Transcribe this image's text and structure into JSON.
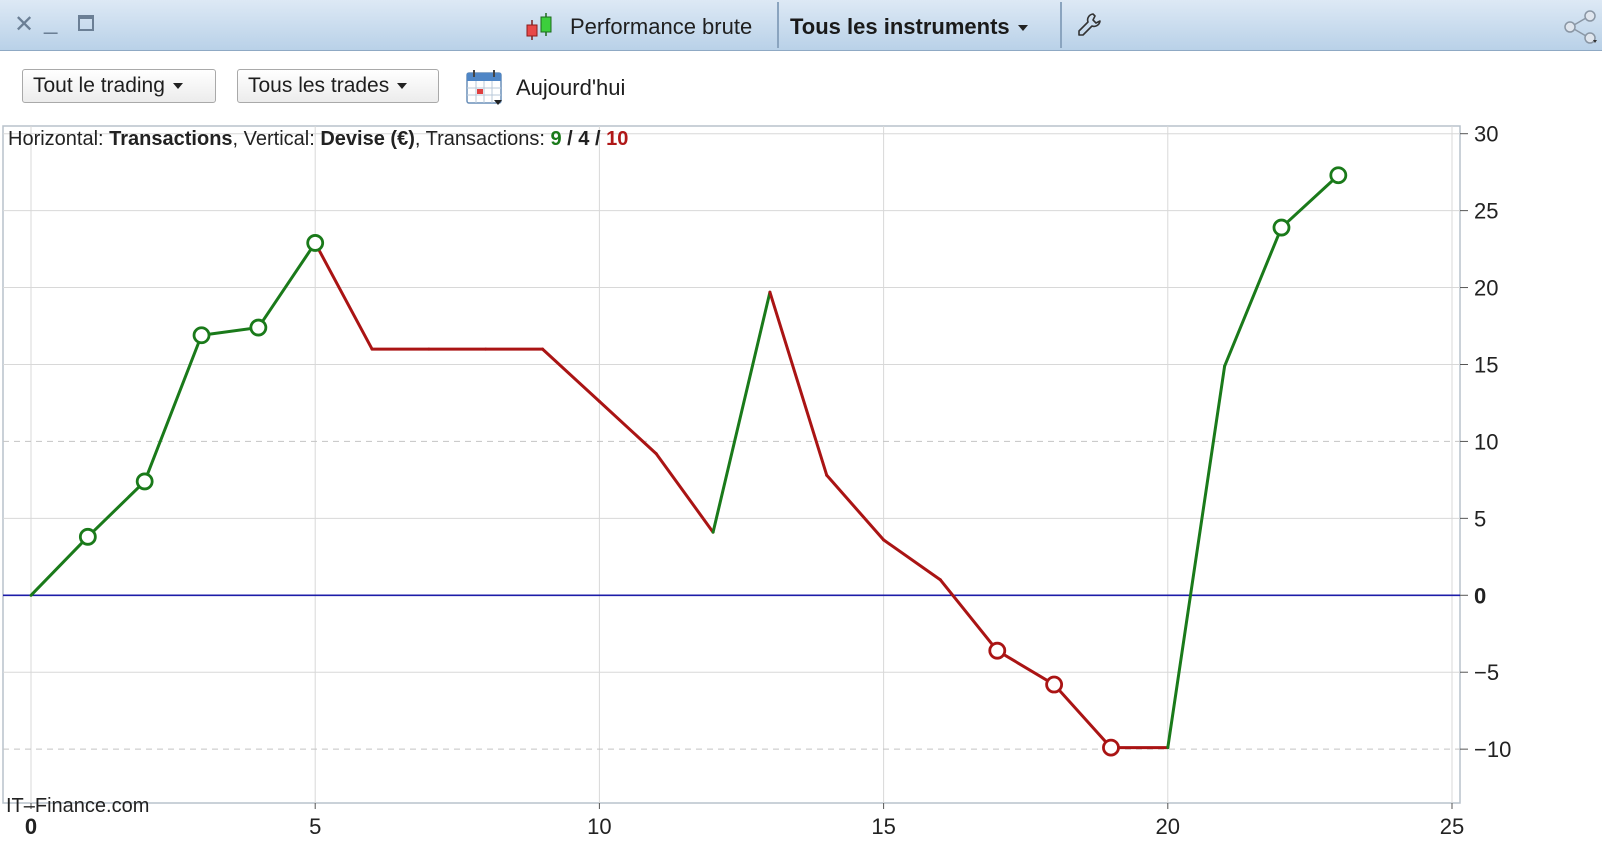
{
  "titlebar": {
    "mode_label": "Performance brute",
    "instruments_label": "Tous les instruments"
  },
  "toolbar": {
    "trading_filter": "Tout le trading",
    "trades_filter": "Tous les trades",
    "date_label": "Aujourd'hui"
  },
  "chart_info": {
    "h_prefix": "Horizontal: ",
    "h_value": "Transactions",
    "v_prefix": ", Vertical: ",
    "v_value": "Devise (€)",
    "t_prefix": ", Transactions: ",
    "count_green": "9",
    "sep1": " / ",
    "count_neutral": "4",
    "sep2": " / ",
    "count_red": "10"
  },
  "watermark": "IT–Finance.com",
  "colors": {
    "gain": "#1a7a1a",
    "loss": "#aa1414",
    "zero_line": "#1c1ca8",
    "grid": "#d8d8d8"
  },
  "chart_data": {
    "type": "line",
    "x": [
      0,
      1,
      2,
      3,
      4,
      5,
      6,
      7,
      8,
      9,
      10,
      11,
      12,
      13,
      14,
      15,
      16,
      17,
      18,
      19,
      20,
      21,
      22,
      23
    ],
    "values": [
      0,
      3.8,
      7.4,
      16.9,
      17.4,
      22.9,
      16.0,
      16.0,
      16.0,
      16.0,
      12.6,
      9.2,
      4.1,
      19.7,
      7.8,
      3.6,
      1.0,
      -3.6,
      -5.8,
      -9.9,
      -9.9,
      14.9,
      23.9,
      27.3
    ],
    "markers": [
      1,
      2,
      3,
      4,
      5,
      17,
      18,
      19,
      22,
      23
    ],
    "xlim": [
      0,
      25
    ],
    "ylim": [
      -13.5,
      30.5
    ],
    "xticks": [
      0,
      5,
      10,
      15,
      20,
      25
    ],
    "yticks": [
      30,
      25,
      20,
      15,
      10,
      5,
      0,
      -5,
      -10
    ],
    "ytick_labels": [
      "30",
      "25",
      "20",
      "15",
      "10",
      "5",
      "0",
      "−5",
      "−10"
    ],
    "grid": true,
    "segment_color_rule": "up=gain, flat/down=loss"
  }
}
